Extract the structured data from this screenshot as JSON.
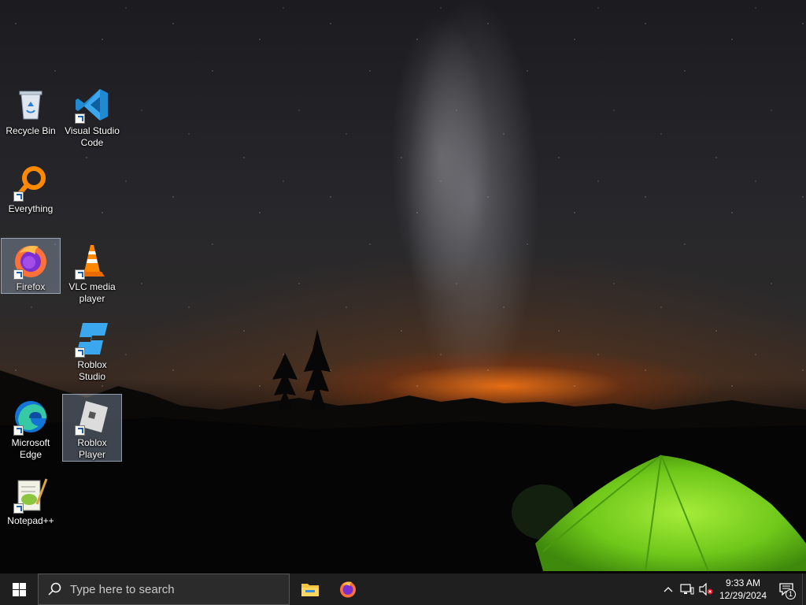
{
  "desktop": {
    "icons": [
      {
        "label": "Recycle Bin",
        "icon": "recycle-bin-icon"
      },
      {
        "label": "Visual Studio Code",
        "icon": "vscode-icon"
      },
      {
        "label": "Everything",
        "icon": "everything-search-icon"
      },
      {
        "label": "Firefox",
        "icon": "firefox-icon"
      },
      {
        "label": "VLC media player",
        "icon": "vlc-cone-icon"
      },
      {
        "label": "Roblox Studio",
        "icon": "roblox-studio-icon"
      },
      {
        "label": "Microsoft Edge",
        "icon": "edge-icon"
      },
      {
        "label": "Roblox Player",
        "icon": "roblox-player-icon"
      },
      {
        "label": "Notepad++",
        "icon": "notepad-plus-plus-icon"
      }
    ],
    "selected": [
      "Firefox",
      "Roblox Player"
    ]
  },
  "taskbar": {
    "search_placeholder": "Type here to search",
    "pinned": [
      {
        "name": "File Explorer",
        "icon": "folder-icon"
      },
      {
        "name": "Firefox",
        "icon": "firefox-icon"
      }
    ],
    "tray": {
      "time": "9:33 AM",
      "date": "12/29/2024",
      "notification_count": "1",
      "icons": [
        "chevron-up-icon",
        "network-icon",
        "volume-muted-icon"
      ]
    }
  },
  "colors": {
    "taskbar_bg": "#1f1f1f",
    "search_bg": "#2b2b2b",
    "selection": "#aabed7",
    "tent_green": "#7cd61e",
    "horizon_glow": "#ff7814"
  }
}
